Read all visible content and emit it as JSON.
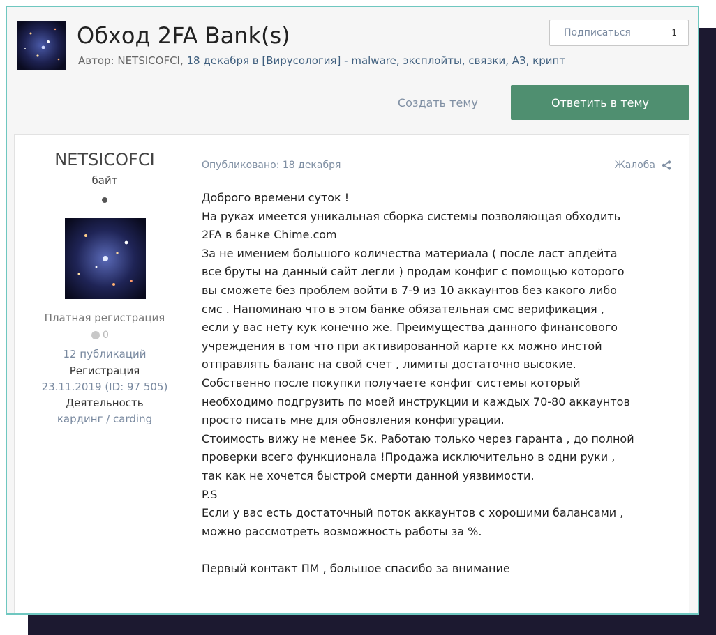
{
  "topic": {
    "title": "Обход 2FA Bank(s)",
    "meta_prefix": "Автор: NETSICOFCI,",
    "meta_rest": " 18 декабря в [Вирусология] - malware, эксплойты, связки, АЗ, крипт",
    "subscribe_label": "Подписаться",
    "subscribe_count": "1"
  },
  "actions": {
    "create_topic": "Создать тему",
    "reply": "Ответить в тему"
  },
  "author": {
    "name": "NETSICOFCI",
    "title": "байт",
    "group": "Платная регистрация",
    "reputation": "0",
    "posts": "12 публикаций",
    "reg_label": "Регистрация",
    "reg_value": "23.11.2019 (ID: 97 505)",
    "activity_label": "Деятельность",
    "activity_value": "кардинг / carding"
  },
  "post": {
    "posted": "Опубликовано: 18 декабря",
    "report": "Жалоба",
    "lines": [
      "Доброго времени суток !",
      "На руках имеется уникальная сборка системы позволяющая обходить",
      "2FA в банке Chime.com",
      "За не имением большого количества материала ( после ласт апдейта",
      "все бруты на данный сайт легли ) продам конфиг с помощью которого",
      "вы сможете без проблем войти в 7-9 из 10 аккаунтов без какого либо",
      "смс . Напоминаю что в этом банке обязательная смс верификация ,",
      "если у вас нету кук конечно же. Преимущества данного финансового",
      "учреждения в том что при активированной карте кх можно инстой",
      "отправлять баланс на свой счет , лимиты достаточно высокие.",
      "Собственно после покупки получаете конфиг системы который",
      "необходимо подгрузить по моей инструкции и каждых 70-80 аккаунтов",
      "просто писать мне для обновления конфигурации.",
      "Стоимость вижу не менее 5к. Работаю только через гаранта , до полной",
      "проверки всего функционала !Продажа исключительно в одни руки ,",
      "так как не хочется быстрой смерти данной уязвимости.",
      "P.S",
      "Если у вас есть достаточный поток аккаунтов с хорошими балансами ,",
      "можно рассмотреть возможность работы за %.",
      "",
      "Первый контакт ПМ , большое спасибо за внимание"
    ]
  },
  "colors": {
    "frame_border": "#6fc7c0",
    "reply_button": "#4f8f70",
    "backdrop": "#1c1930"
  },
  "icons": [
    "galaxy-thumbnail-icon",
    "online-dot-icon",
    "reputation-dot-icon",
    "share-icon"
  ]
}
